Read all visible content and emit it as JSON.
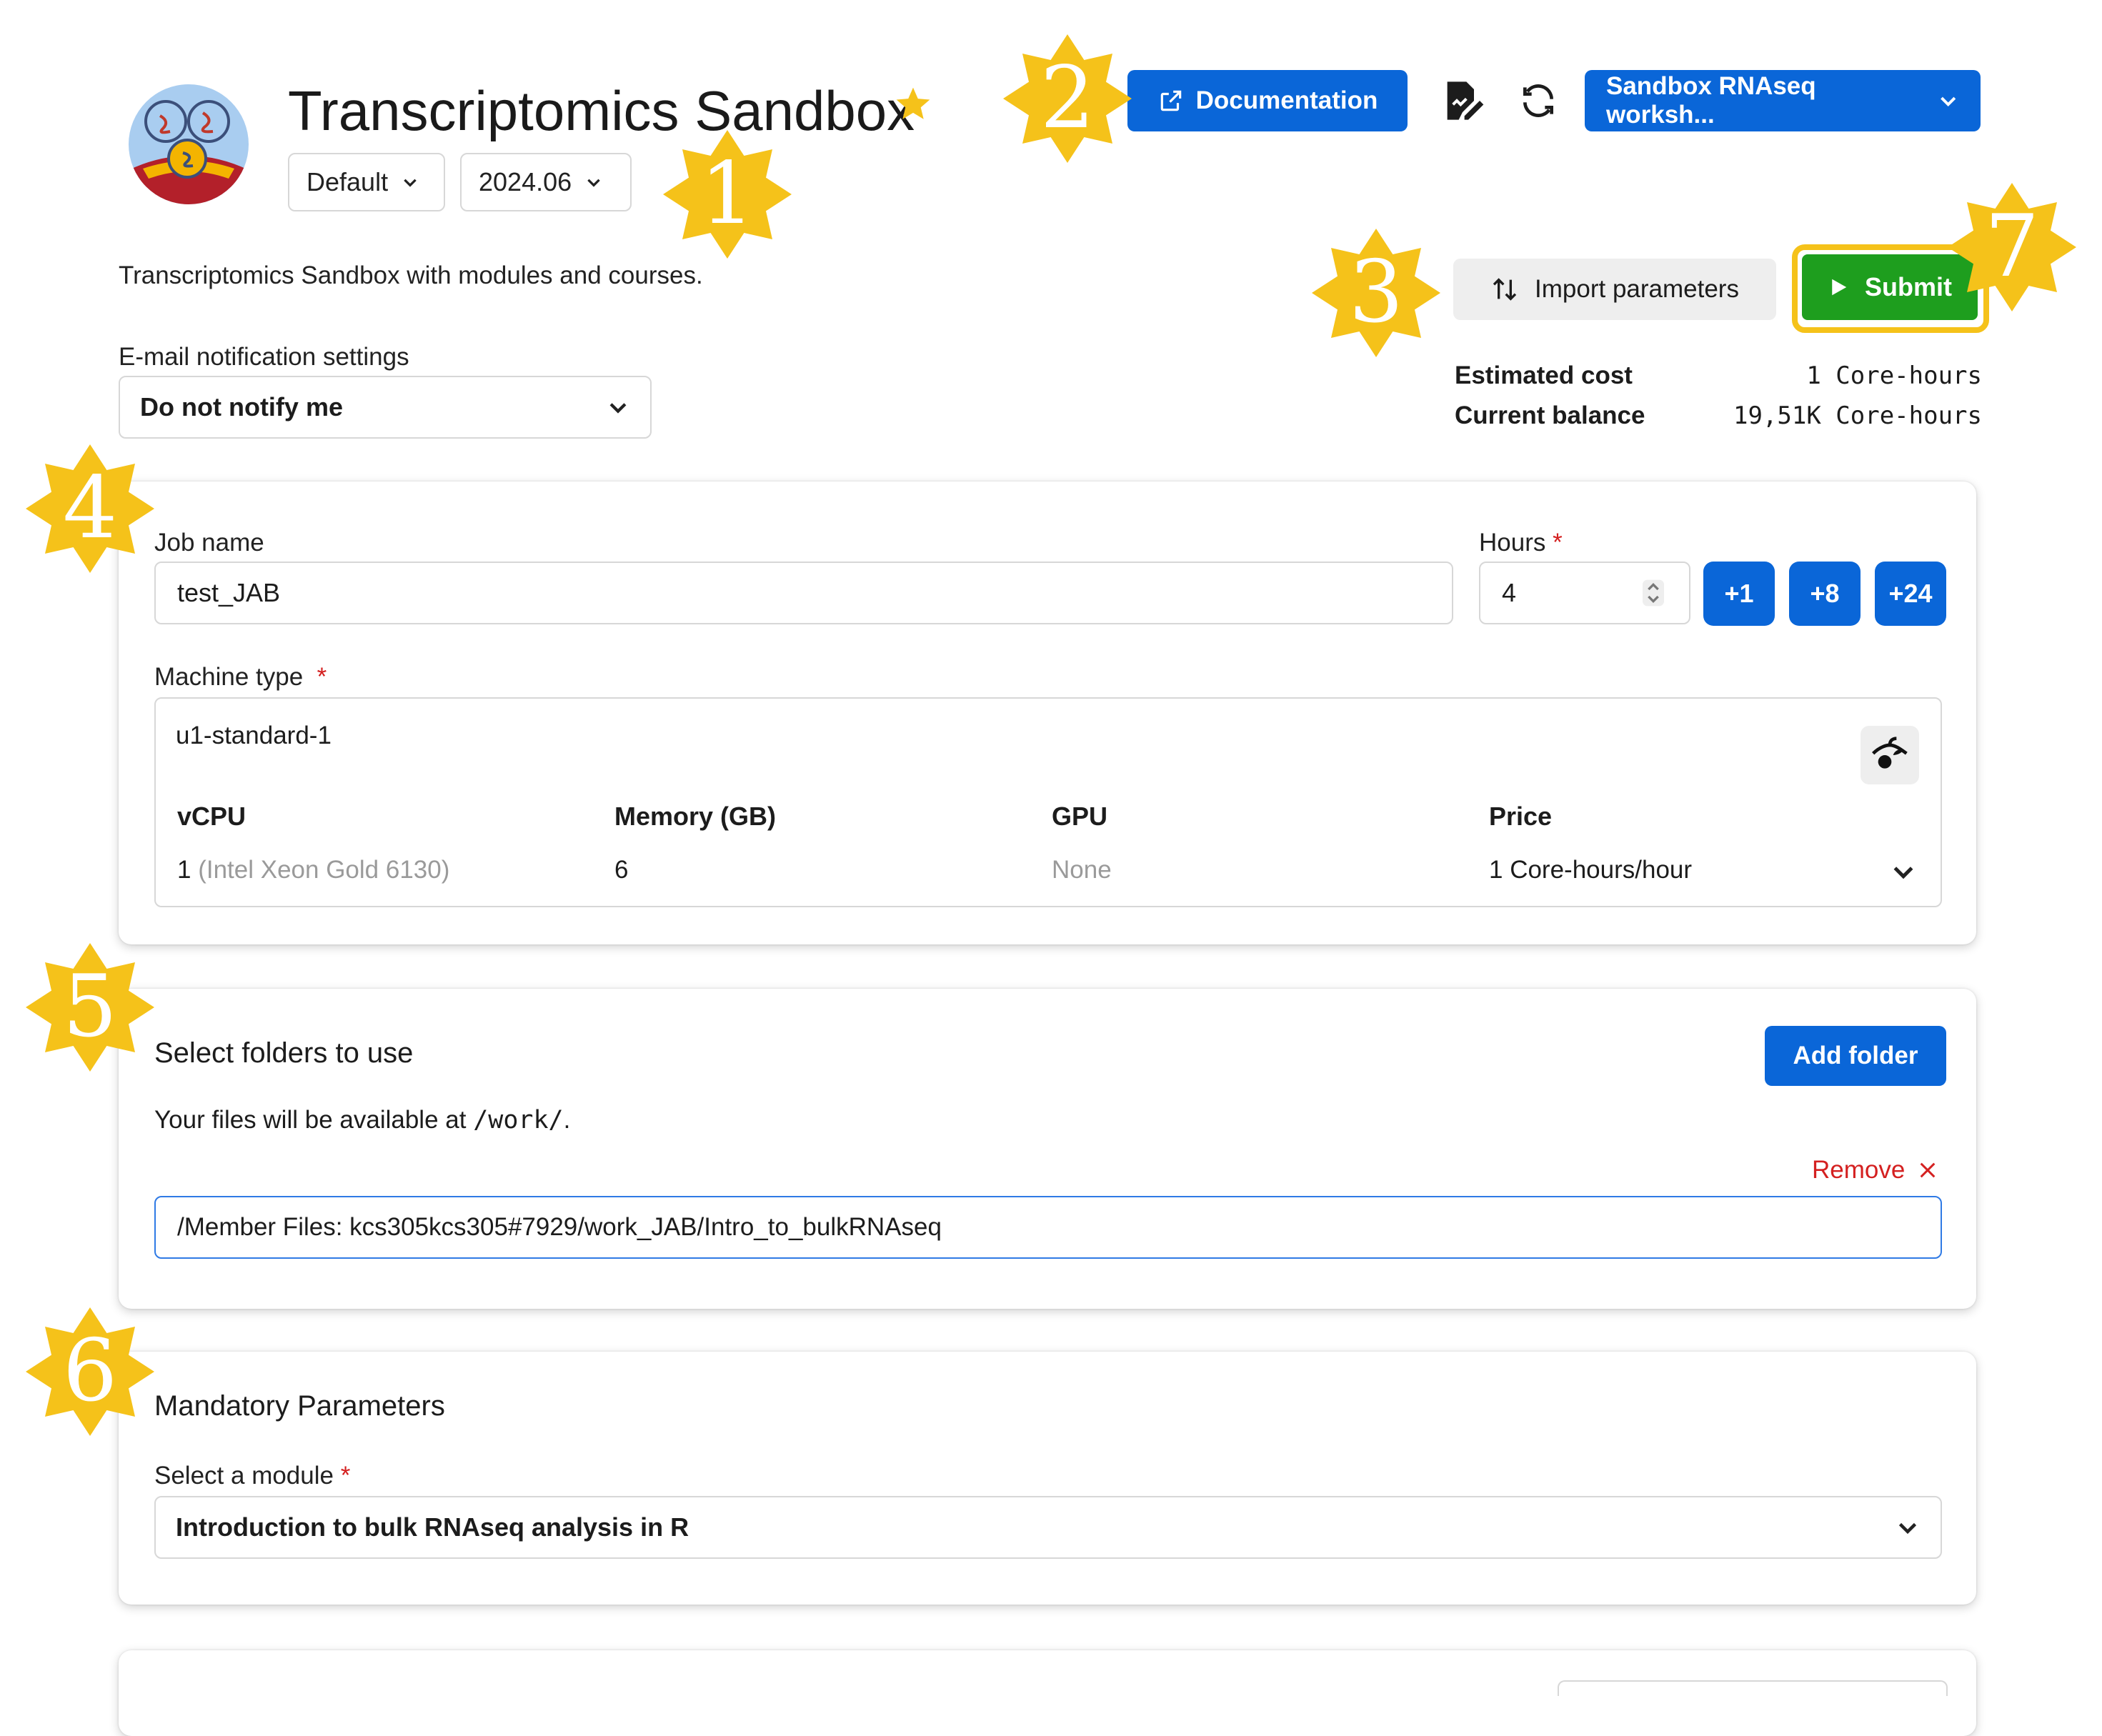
{
  "header": {
    "title": "Transcriptomics Sandbox",
    "profile_select": "Default",
    "version_select": "2024.06",
    "description": "Transcriptomics Sandbox with modules and courses."
  },
  "toolbar": {
    "documentation_label": "Documentation",
    "project_select": "Sandbox RNAseq worksh...",
    "import_label": "Import parameters",
    "submit_label": "Submit"
  },
  "cost": {
    "estimated_label": "Estimated cost",
    "estimated_value": "1 Core-hours",
    "balance_label": "Current balance",
    "balance_value": "19,51K Core-hours"
  },
  "notification": {
    "label": "E-mail notification settings",
    "value": "Do not notify me"
  },
  "job": {
    "name_label": "Job name",
    "name_value": "test_JAB",
    "hours_label": "Hours",
    "hours_value": "4",
    "increments": [
      "+1",
      "+8",
      "+24"
    ],
    "machine_label": "Machine type",
    "machine_value": "u1-standard-1",
    "columns": {
      "vcpu": "vCPU",
      "memory": "Memory (GB)",
      "gpu": "GPU",
      "price": "Price"
    },
    "values": {
      "vcpu_count": "1",
      "vcpu_detail": "(Intel Xeon Gold 6130)",
      "memory": "6",
      "gpu": "None",
      "price": "1 Core-hours/hour"
    }
  },
  "folders": {
    "title": "Select folders to use",
    "add_label": "Add folder",
    "info_prefix": "Your files will be available at ",
    "info_path": "/work/",
    "info_suffix": ".",
    "remove_label": "Remove",
    "folder_value": "/Member Files: kcs305kcs305#7929/work_JAB/Intro_to_bulkRNAseq"
  },
  "mandatory": {
    "title": "Mandatory Parameters",
    "module_label": "Select a module",
    "module_value": "Introduction to bulk RNAseq analysis in R"
  },
  "annotations": [
    "1",
    "2",
    "3",
    "4",
    "5",
    "6",
    "7"
  ],
  "colors": {
    "primary": "#0a66d8",
    "submit": "#1e9e1e",
    "badge": "#f5c21a",
    "danger": "#d42020"
  }
}
